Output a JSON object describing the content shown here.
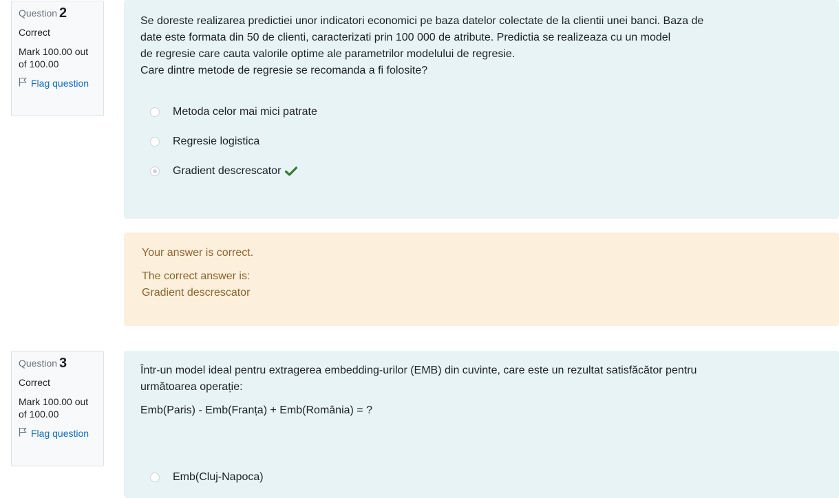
{
  "q2": {
    "info": {
      "label": "Question",
      "number": "2",
      "state": "Correct",
      "grade_line1": "Mark 100.00 out",
      "grade_line2": "of 100.00",
      "flag": "Flag question"
    },
    "text": [
      "Se doreste realizarea predictiei unor indicatori economici pe baza datelor colectate de la clientii unei banci. Baza de",
      "date este formata din 50 de clienti, caracterizati prin 100 000 de atribute. Predictia se realizeaza cu un model",
      "de regresie care cauta valorile optime ale parametrilor modelului de regresie.",
      "Care dintre metode de regresie se recomanda a fi folosite?"
    ],
    "answers": [
      {
        "label": "Metoda celor mai mici patrate",
        "checked": false
      },
      {
        "label": "Regresie logistica",
        "checked": false
      },
      {
        "label": "Gradient descrescator",
        "checked": true
      }
    ],
    "feedback": {
      "general": "Your answer is correct.",
      "right_intro": "The correct answer is:",
      "right_answer": "Gradient descrescator"
    }
  },
  "q3": {
    "info": {
      "label": "Question",
      "number": "3",
      "state": "Correct",
      "grade_line1": "Mark 100.00 out",
      "grade_line2": "of 100.00",
      "flag": "Flag question"
    },
    "text_line1": "Într-un model ideal pentru extragerea embedding-urilor (EMB) din cuvinte, care este un rezultat satisfăcător pentru",
    "text_line2": "următoarea operație:",
    "formula": "Emb(Paris) - Emb(Franța) + Emb(România) = ?",
    "answers": [
      {
        "label": "Emb(Cluj-Napoca)",
        "checked": false
      }
    ]
  },
  "colors": {
    "formulation_bg": "#e7f3f5",
    "feedback_bg": "#fcefdc",
    "feedback_text": "#8e662e",
    "link": "#0f6cbf",
    "correct_check": "#357a32"
  }
}
